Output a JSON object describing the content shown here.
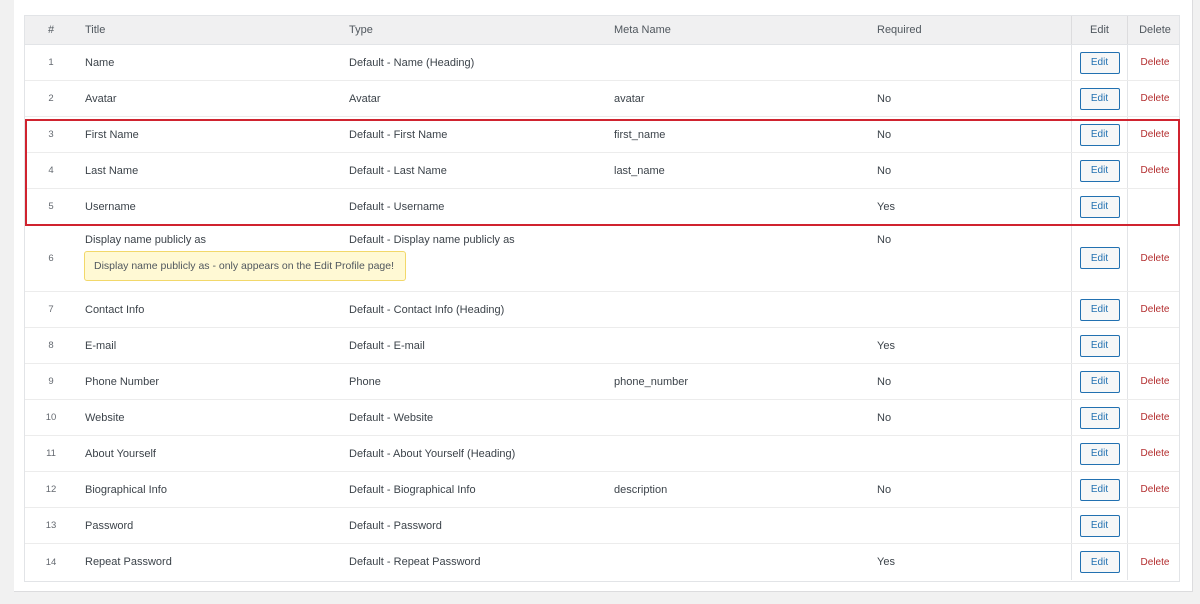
{
  "columns": {
    "num": "#",
    "title": "Title",
    "type": "Type",
    "meta": "Meta Name",
    "required": "Required",
    "edit": "Edit",
    "delete": "Delete"
  },
  "rows": [
    {
      "num": "1",
      "title": "Name",
      "type": "Default - Name (Heading)",
      "meta": "",
      "required": "",
      "edit": "Edit",
      "delete": "Delete"
    },
    {
      "num": "2",
      "title": "Avatar",
      "type": "Avatar",
      "meta": "avatar",
      "required": "No",
      "edit": "Edit",
      "delete": "Delete"
    },
    {
      "num": "3",
      "title": "First Name",
      "type": "Default - First Name",
      "meta": "first_name",
      "required": "No",
      "edit": "Edit",
      "delete": "Delete"
    },
    {
      "num": "4",
      "title": "Last Name",
      "type": "Default - Last Name",
      "meta": "last_name",
      "required": "No",
      "edit": "Edit",
      "delete": "Delete"
    },
    {
      "num": "5",
      "title": "Username",
      "type": "Default - Username",
      "meta": "",
      "required": "Yes",
      "edit": "Edit",
      "delete": ""
    },
    {
      "num": "6",
      "title": "Display name publicly as",
      "type": "Default - Display name publicly as",
      "meta": "",
      "required": "No",
      "edit": "Edit",
      "delete": "Delete"
    },
    {
      "num": "7",
      "title": "Contact Info",
      "type": "Default - Contact Info (Heading)",
      "meta": "",
      "required": "",
      "edit": "Edit",
      "delete": "Delete"
    },
    {
      "num": "8",
      "title": "E-mail",
      "type": "Default - E-mail",
      "meta": "",
      "required": "Yes",
      "edit": "Edit",
      "delete": ""
    },
    {
      "num": "9",
      "title": "Phone Number",
      "type": "Phone",
      "meta": "phone_number",
      "required": "No",
      "edit": "Edit",
      "delete": "Delete"
    },
    {
      "num": "10",
      "title": "Website",
      "type": "Default - Website",
      "meta": "",
      "required": "No",
      "edit": "Edit",
      "delete": "Delete"
    },
    {
      "num": "11",
      "title": "About Yourself",
      "type": "Default - About Yourself (Heading)",
      "meta": "",
      "required": "",
      "edit": "Edit",
      "delete": "Delete"
    },
    {
      "num": "12",
      "title": "Biographical Info",
      "type": "Default - Biographical Info",
      "meta": "description",
      "required": "No",
      "edit": "Edit",
      "delete": "Delete"
    },
    {
      "num": "13",
      "title": "Password",
      "type": "Default - Password",
      "meta": "",
      "required": "",
      "edit": "Edit",
      "delete": ""
    },
    {
      "num": "14",
      "title": "Repeat Password",
      "type": "Default - Repeat Password",
      "meta": "",
      "required": "Yes",
      "edit": "Edit",
      "delete": "Delete"
    }
  ],
  "tooltip": "Display name publicly as - only appears on the Edit Profile page!",
  "colors": {
    "highlight": "#d0232f",
    "link": "#2271b1",
    "delete": "#b32d2e",
    "tooltip_bg": "#fff9d4"
  }
}
